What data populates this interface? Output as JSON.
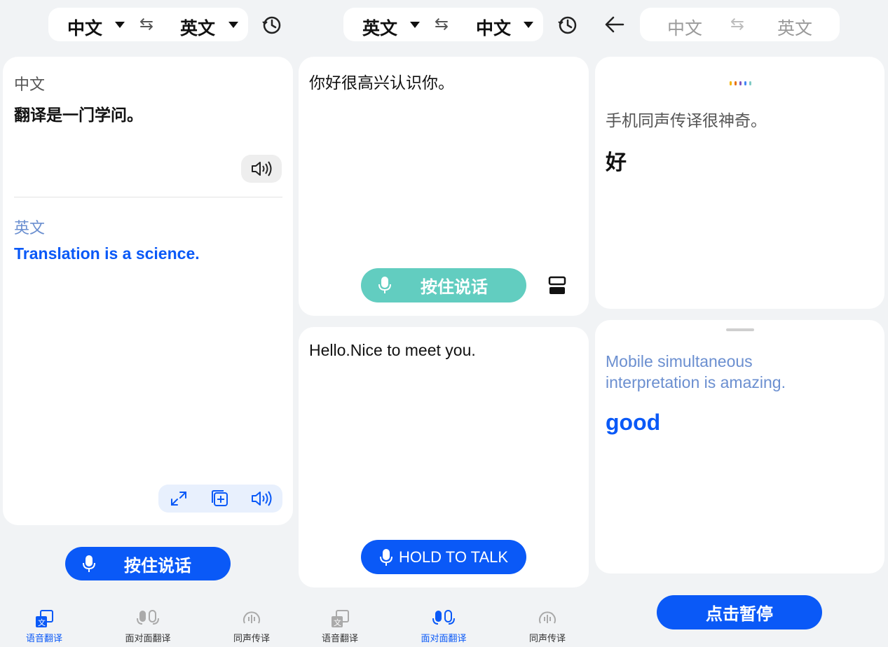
{
  "panel1": {
    "source_lang": "中文",
    "target_lang": "英文",
    "source_label": "中文",
    "source_text": "翻译是一门学问。",
    "target_label": "英文",
    "target_text": "Translation is a science.",
    "hold_button": "按住说话"
  },
  "panel2": {
    "source_lang": "英文",
    "target_lang": "中文",
    "top_text": "你好很高兴认识你。",
    "top_button": "按住说话",
    "bottom_text": "Hello.Nice to meet you.",
    "bottom_button": "HOLD TO TALK"
  },
  "panel3": {
    "source_lang": "中文",
    "target_lang": "英文",
    "source_text": "手机同声传译很神奇。",
    "source_live": "好",
    "target_text": "Mobile simultaneous interpretation is amazing.",
    "target_live": "good",
    "pause_button": "点击暂停"
  },
  "nav": {
    "voice": "语音翻译",
    "face": "面对面翻译",
    "simul": "同声传译"
  },
  "colors": {
    "accent": "#0a59f7",
    "teal": "#62cdc0",
    "muted_blue": "#6b8fd0"
  }
}
